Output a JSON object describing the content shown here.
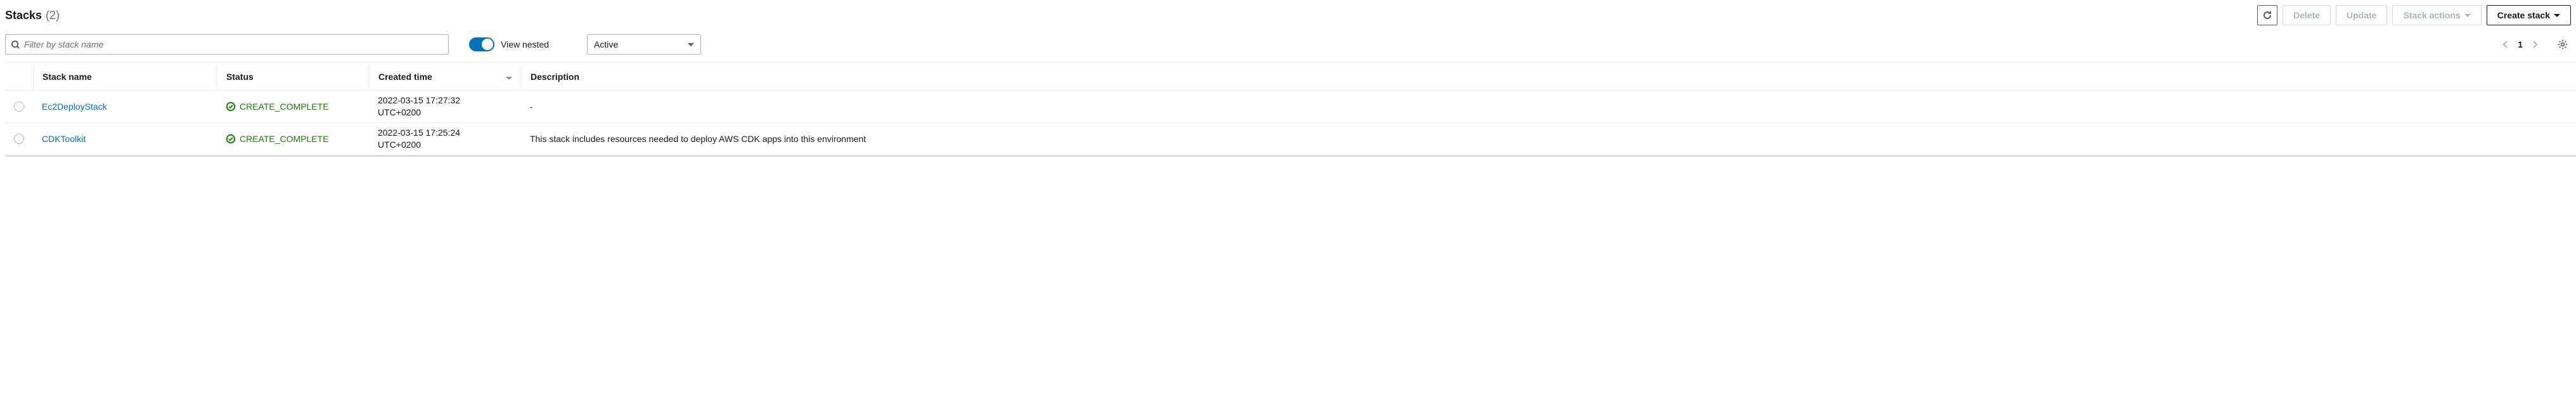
{
  "header": {
    "title": "Stacks",
    "count": "(2)"
  },
  "actions": {
    "delete": "Delete",
    "update": "Update",
    "stack_actions": "Stack actions",
    "create_stack": "Create stack"
  },
  "controls": {
    "search_placeholder": "Filter by stack name",
    "view_nested_label": "View nested",
    "status_filter": "Active",
    "page": "1"
  },
  "table": {
    "headers": {
      "name": "Stack name",
      "status": "Status",
      "created": "Created time",
      "description": "Description"
    },
    "rows": [
      {
        "name": "Ec2DeployStack",
        "status": "CREATE_COMPLETE",
        "created_line1": "2022-03-15 17:27:32",
        "created_line2": "UTC+0200",
        "description": "-"
      },
      {
        "name": "CDKToolkit",
        "status": "CREATE_COMPLETE",
        "created_line1": "2022-03-15 17:25:24",
        "created_line2": "UTC+0200",
        "description": "This stack includes resources needed to deploy AWS CDK apps into this environment"
      }
    ]
  }
}
